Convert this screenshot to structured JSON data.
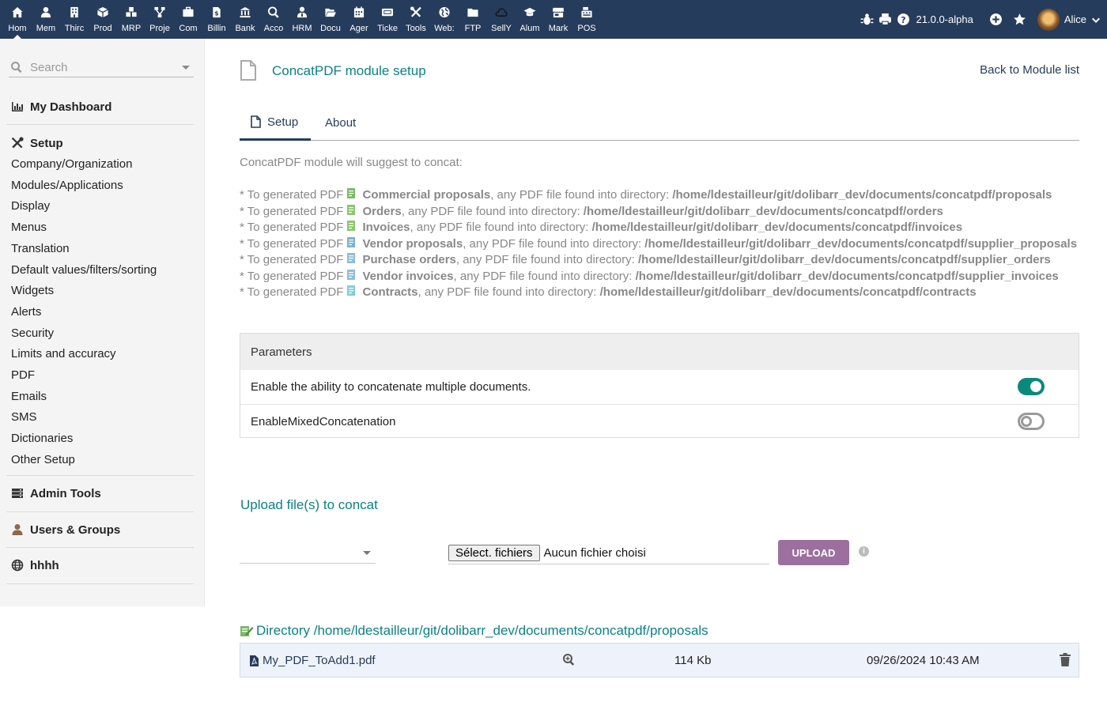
{
  "topmenu": [
    {
      "label": "Hom",
      "icon": "home-icon"
    },
    {
      "label": "Mem",
      "icon": "member-icon"
    },
    {
      "label": "Thirc",
      "icon": "building-icon"
    },
    {
      "label": "Prod",
      "icon": "cube-icon"
    },
    {
      "label": "MRP",
      "icon": "cubes-icon"
    },
    {
      "label": "Proje",
      "icon": "project-icon"
    },
    {
      "label": "Com",
      "icon": "briefcase-icon"
    },
    {
      "label": "Billin",
      "icon": "invoice-icon"
    },
    {
      "label": "Bank",
      "icon": "bank-icon"
    },
    {
      "label": "Acco",
      "icon": "search-dollar-icon"
    },
    {
      "label": "HRM",
      "icon": "user-tie-icon"
    },
    {
      "label": "Docu",
      "icon": "folder-open-icon"
    },
    {
      "label": "Ager",
      "icon": "calendar-icon"
    },
    {
      "label": "Ticke",
      "icon": "ticket-icon"
    },
    {
      "label": "Tools",
      "icon": "tools-icon"
    },
    {
      "label": "Web:",
      "icon": "globe-icon"
    },
    {
      "label": "FTP",
      "icon": "folder-icon"
    },
    {
      "label": "SellY",
      "icon": "cloud-icon"
    },
    {
      "label": "Alum",
      "icon": "graduation-cap-icon"
    },
    {
      "label": "Mark",
      "icon": "store-icon"
    },
    {
      "label": "POS",
      "icon": "cash-register-icon"
    }
  ],
  "topright": {
    "version": "21.0.0-alpha",
    "username": "Alice"
  },
  "sidebar": {
    "search_placeholder": "Search",
    "dashboard": "My Dashboard",
    "setup": "Setup",
    "items": [
      "Company/Organization",
      "Modules/Applications",
      "Display",
      "Menus",
      "Translation",
      "Default values/filters/sorting",
      "Widgets",
      "Alerts",
      "Security",
      "Limits and accuracy",
      "PDF",
      "Emails",
      "SMS",
      "Dictionaries",
      "Other Setup"
    ],
    "admin_tools": "Admin Tools",
    "users_groups": "Users & Groups",
    "hhhh": "hhhh"
  },
  "main": {
    "title": "ConcatPDF module setup",
    "back_link": "Back to Module list",
    "tabs": [
      "Setup",
      "About"
    ],
    "intro": "ConcatPDF module will suggest to concat:",
    "concat_lines": [
      {
        "prefix": "* To generated PDF",
        "name": "Commercial proposals",
        "mid": ", any PDF file found into directory: ",
        "path": "/home/ldestailleur/git/dolibarr_dev/documents/concatpdf/proposals",
        "color": "#7cb86a"
      },
      {
        "prefix": "* To generated PDF",
        "name": "Orders",
        "mid": ", any PDF file found into directory: ",
        "path": "/home/ldestailleur/git/dolibarr_dev/documents/concatpdf/orders",
        "color": "#8cc66e"
      },
      {
        "prefix": "* To generated PDF",
        "name": "Invoices",
        "mid": ", any PDF file found into directory: ",
        "path": "/home/ldestailleur/git/dolibarr_dev/documents/concatpdf/invoices",
        "color": "#8cc66e"
      },
      {
        "prefix": "* To generated PDF",
        "name": "Vendor proposals",
        "mid": ", any PDF file found into directory: ",
        "path": "/home/ldestailleur/git/dolibarr_dev/documents/concatpdf/supplier_proposals",
        "color": "#7ab0d6"
      },
      {
        "prefix": "* To generated PDF",
        "name": "Purchase orders",
        "mid": ", any PDF file found into directory: ",
        "path": "/home/ldestailleur/git/dolibarr_dev/documents/concatpdf/supplier_orders",
        "color": "#8abde0"
      },
      {
        "prefix": "* To generated PDF",
        "name": "Vendor invoices",
        "mid": ", any PDF file found into directory: ",
        "path": "/home/ldestailleur/git/dolibarr_dev/documents/concatpdf/supplier_invoices",
        "color": "#8abde0"
      },
      {
        "prefix": "* To generated PDF",
        "name": "Contracts",
        "mid": ", any PDF file found into directory: ",
        "path": "/home/ldestailleur/git/dolibarr_dev/documents/concatpdf/contracts",
        "color": "#7ed0d6"
      }
    ],
    "parameters": {
      "header": "Parameters",
      "rows": [
        {
          "label": "Enable the ability to concatenate multiple documents.",
          "enabled": true
        },
        {
          "label": "EnableMixedConcatenation",
          "enabled": false
        }
      ]
    },
    "upload": {
      "title": "Upload file(s) to concat",
      "file_button": "Sélect. fichiers",
      "file_text": "Aucun fichier choisi",
      "upload_button": "UPLOAD"
    },
    "directory": {
      "title": "Directory /home/ldestailleur/git/dolibarr_dev/documents/concatpdf/proposals",
      "file": {
        "name": "My_PDF_ToAdd1.pdf",
        "size": "114 Kb",
        "date": "09/26/2024 10:43 AM"
      }
    }
  },
  "colors": {
    "topbar": "#263c5c",
    "accent_teal": "#0a8289",
    "upload_button": "#9c6f9f",
    "toggle_on": "#0a8a7a"
  }
}
